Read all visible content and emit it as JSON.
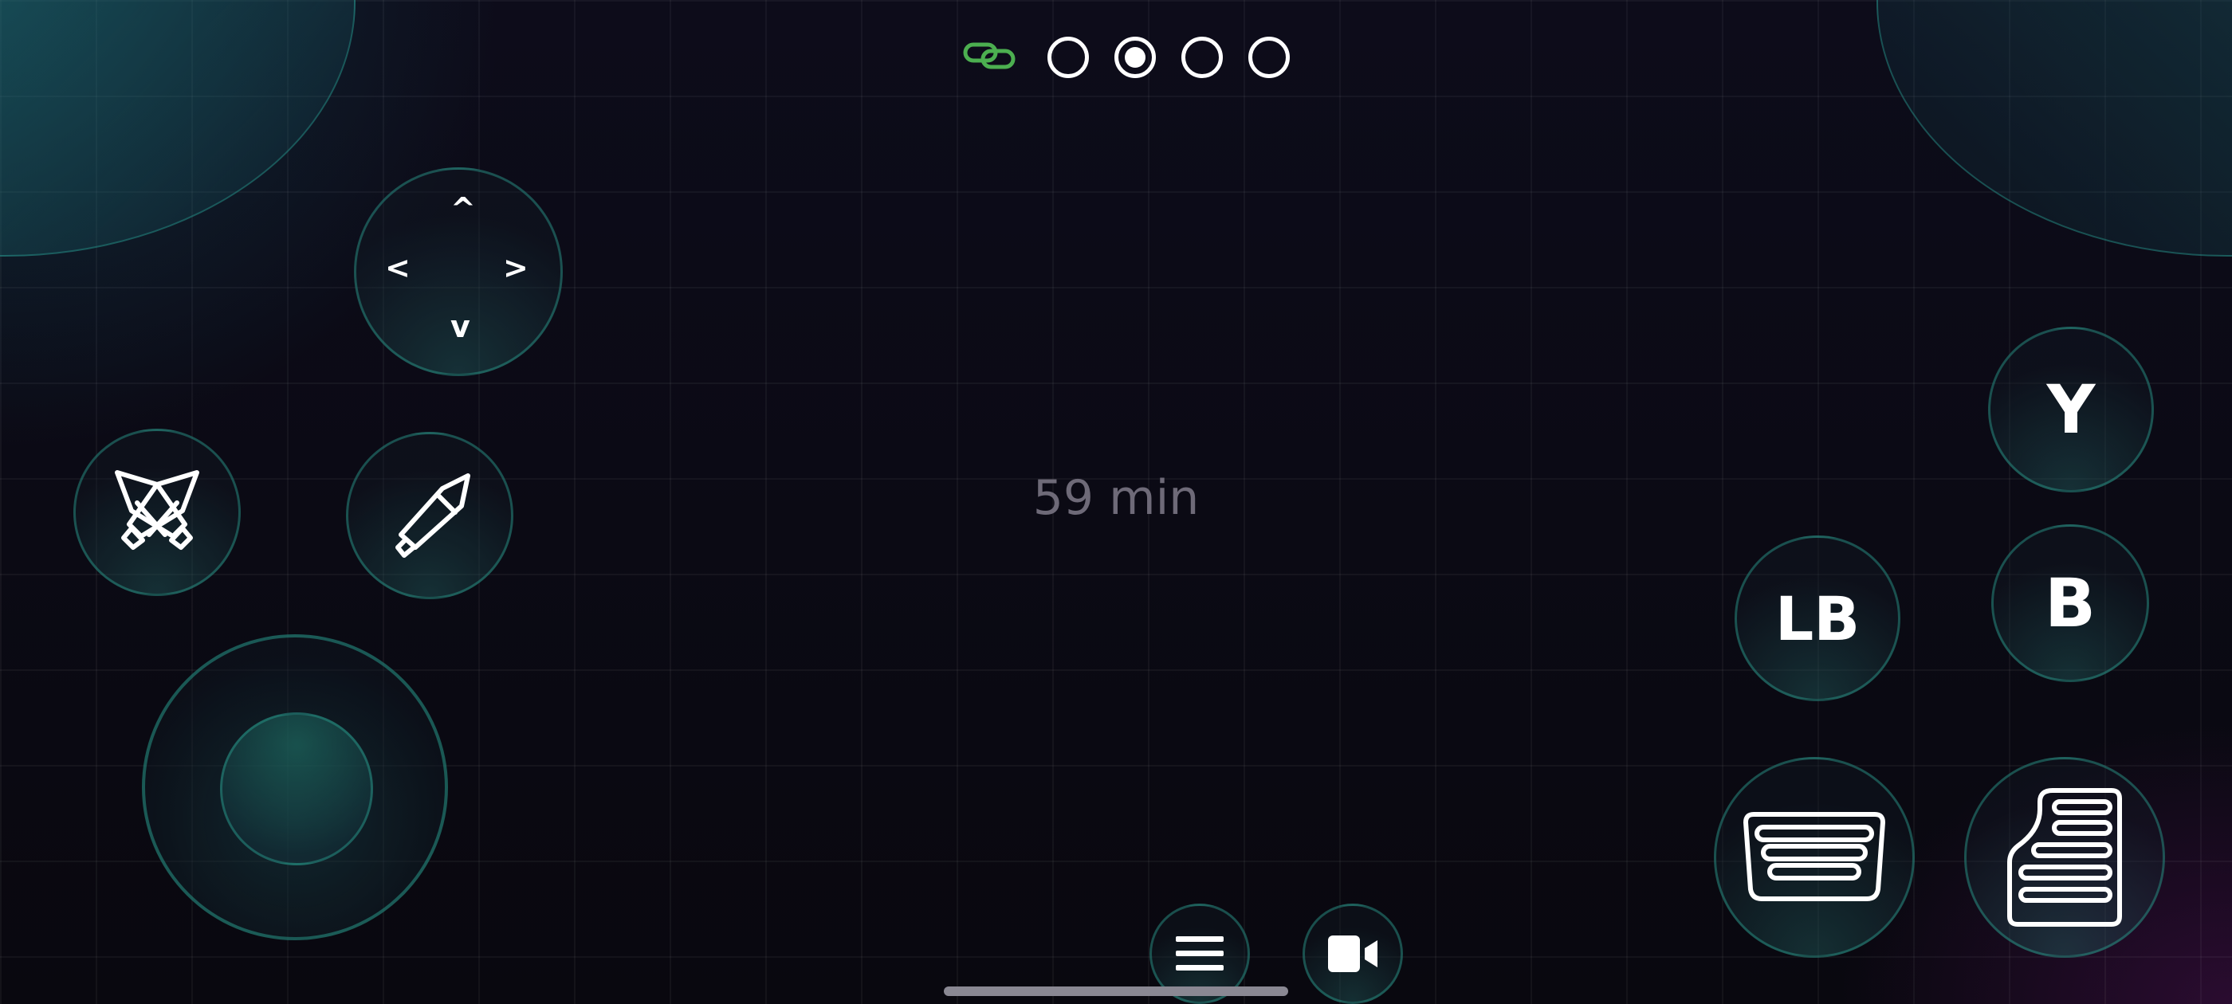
{
  "status": {
    "connection_icon": "link-icon",
    "connection_color": "#4caf50",
    "pages": [
      {
        "active": false
      },
      {
        "active": true
      },
      {
        "active": false
      },
      {
        "active": false
      }
    ]
  },
  "timer": {
    "text": "59 min",
    "color": "#6e6a78"
  },
  "dpad": {
    "up": "^",
    "down": "v",
    "left": "<",
    "right": ">"
  },
  "buttons": {
    "y": "Y",
    "b": "B",
    "lb": "LB",
    "swords_icon": "crossed-swords-icon",
    "pen_icon": "pen-icon",
    "cards_icon": "cards-stack-icon",
    "list_icon": "list-sheet-icon",
    "menu_icon": "hamburger-menu-icon",
    "video_icon": "video-camera-icon"
  },
  "theme": {
    "accent": "#2da091",
    "background": "#0a0912",
    "text": "#ffffff"
  }
}
